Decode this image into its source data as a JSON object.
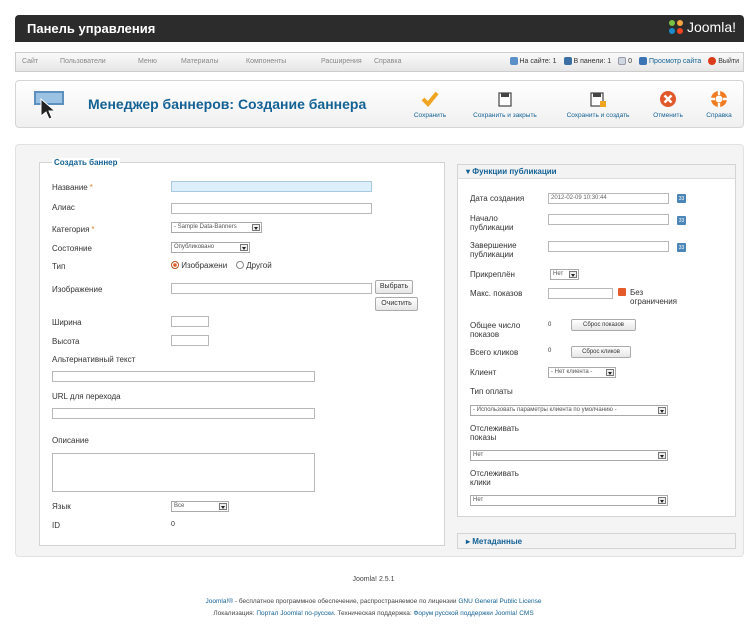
{
  "app": {
    "title": "Панель управления",
    "logo_text": "Joomla!"
  },
  "menu": {
    "items": [
      "Сайт",
      "Пользователи",
      "Меню",
      "Материалы",
      "Компоненты",
      "Расширения",
      "Справка"
    ]
  },
  "status": {
    "on_site": "На сайте: 1",
    "in_panel": "В панели: 1",
    "messages": "0",
    "view_site": "Просмотр сайта",
    "logout": "Выйти"
  },
  "toolbar": {
    "page_title": "Менеджер баннеров: Создание баннера",
    "save": "Сохранить",
    "save_close": "Сохранить и закрыть",
    "save_new": "Сохранить и создать",
    "cancel": "Отменить",
    "help": "Справка"
  },
  "form": {
    "legend": "Создать баннер",
    "name_label": "Название",
    "name_value": "",
    "alias_label": "Алиас",
    "alias_value": "",
    "category_label": "Категория",
    "category_value": "- Sample Data-Banners",
    "state_label": "Состояние",
    "state_value": "Опубликовано",
    "type_label": "Тип",
    "type_image": "Изображени",
    "type_other": "Другой",
    "image_label": "Изображение",
    "image_value": "",
    "select_button": "Выбрать",
    "clear_button": "Очистить",
    "width_label": "Ширина",
    "width_value": "",
    "height_label": "Высота",
    "height_value": "",
    "alt_label": "Альтернативный текст",
    "alt_value": "",
    "url_label": "URL для перехода",
    "url_value": "",
    "description_label": "Описание",
    "description_value": "",
    "language_label": "Язык",
    "language_value": "Все",
    "id_label": "ID",
    "id_value": "0"
  },
  "publish": {
    "header": "Функции публикации",
    "created_label": "Дата создания",
    "created_value": "2012-02-09 10:30:44",
    "start_label": "Начало публикации",
    "start_value": "",
    "end_label": "Завершение публикации",
    "end_value": "",
    "pinned_label": "Прикреплён",
    "pinned_value": "Нет",
    "max_label": "Макс. показов",
    "max_value": "",
    "unlimited_label": "Без ограничения",
    "total_impr_label": "Общее число показов",
    "total_impr_value": "0",
    "reset_impr": "Сброс показов",
    "total_clicks_label": "Всего кликов",
    "total_clicks_value": "0",
    "reset_clicks": "Сброс кликов",
    "client_label": "Клиент",
    "client_value": "- Нет клиента -",
    "pay_label": "Тип оплаты",
    "pay_value": "- Использовать параметры клиента по умолчанию -",
    "track_impr_label": "Отслеживать показы",
    "track_impr_value": "Нет",
    "track_clicks_label": "Отслеживать клики",
    "track_clicks_value": "Нет",
    "metadata_header": "Метаданные"
  },
  "footer": {
    "version": "Joomla! 2.5.1",
    "line2_link1": "Joomla!®",
    "line2_text": " - бесплатное программное обеспечение, распространяемое по лицензии ",
    "line2_link2": "GNU General Public License",
    "line3_text1": "Локализация: ",
    "line3_link1": "Портал Joomla! по-русски",
    "line3_text2": ". Техническая поддержка: ",
    "line3_link2": "Форум русской поддержки Joomla! CMS"
  },
  "colors": {
    "accent": "#146295",
    "topbar": "#2c2c2c",
    "orange": "#e0592a"
  }
}
